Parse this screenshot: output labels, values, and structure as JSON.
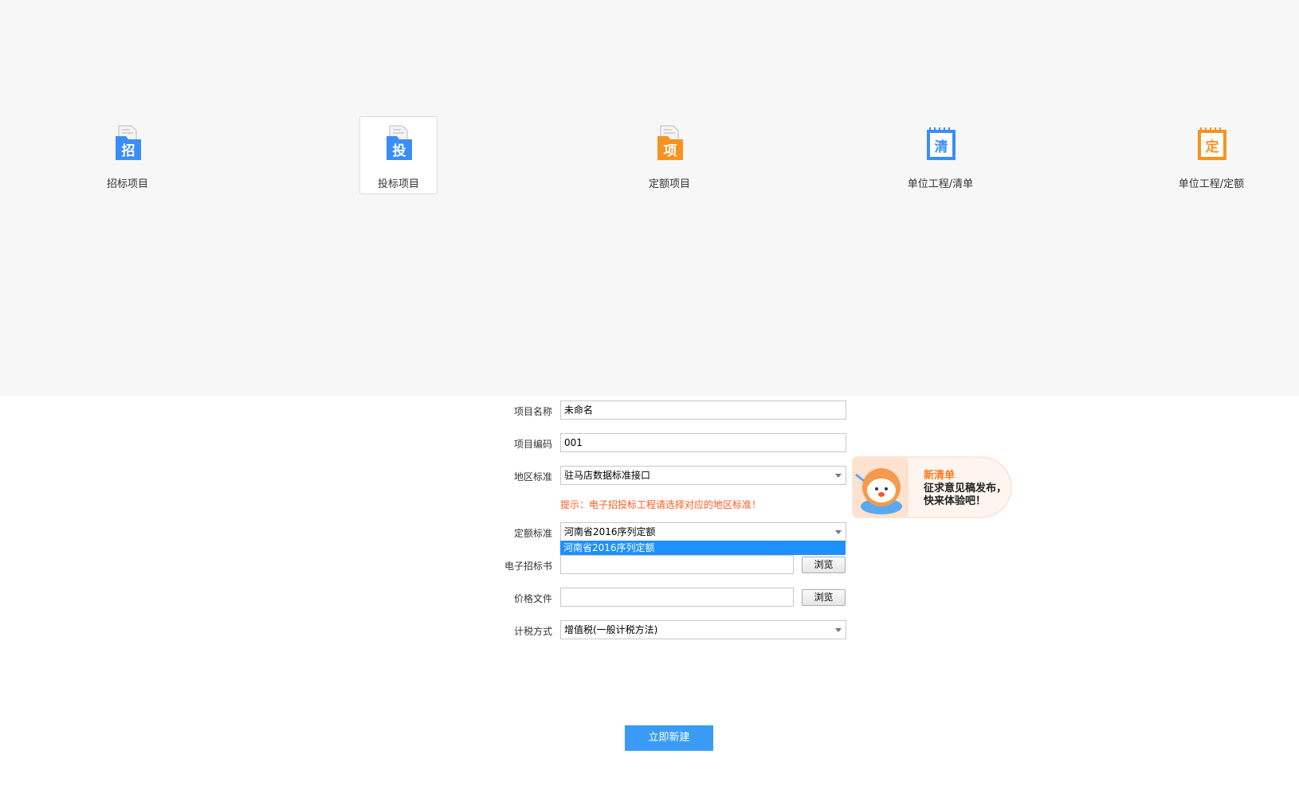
{
  "project_types": [
    {
      "label": "招标项目",
      "glyph": "招",
      "color": "#3a8ef6",
      "icon": "document-stack-icon",
      "selected": false
    },
    {
      "label": "投标项目",
      "glyph": "投",
      "color": "#3a8ef6",
      "icon": "document-stack-icon",
      "selected": true
    },
    {
      "label": "定额项目",
      "glyph": "项",
      "color": "#f7931e",
      "icon": "document-stack-icon",
      "selected": false
    },
    {
      "label": "单位工程/清单",
      "glyph": "清",
      "color": "#3a8ef6",
      "icon": "notepad-icon",
      "selected": false
    },
    {
      "label": "单位工程/定额",
      "glyph": "定",
      "color": "#f7931e",
      "icon": "notepad-icon",
      "selected": false
    }
  ],
  "form": {
    "project_name": {
      "label": "项目名称",
      "value": "未命名"
    },
    "project_code": {
      "label": "项目编码",
      "value": "001"
    },
    "region_standard": {
      "label": "地区标准",
      "value": "驻马店数据标准接口"
    },
    "hint": "提示：电子招投标工程请选择对应的地区标准！",
    "quota_standard": {
      "label": "定额标准",
      "value": "河南省2016序列定额",
      "dropdown_option": "河南省2016序列定额"
    },
    "tender_file": {
      "label": "电子招标书",
      "value": "",
      "button": "浏览"
    },
    "price_file": {
      "label": "价格文件",
      "value": "",
      "button": "浏览"
    },
    "tax_method": {
      "label": "计税方式",
      "value": "增值税(一般计税方法)"
    }
  },
  "banner": {
    "title": "新清单",
    "desc_line1": "征求意见稿发布，",
    "desc_line2": "快来体验吧！",
    "bg_color": "#fde9dd"
  },
  "submit_label": "立即新建",
  "colors": {
    "accent": "#3a9bf7",
    "hint": "#ff5a1f",
    "selection": "#1e90ff"
  }
}
